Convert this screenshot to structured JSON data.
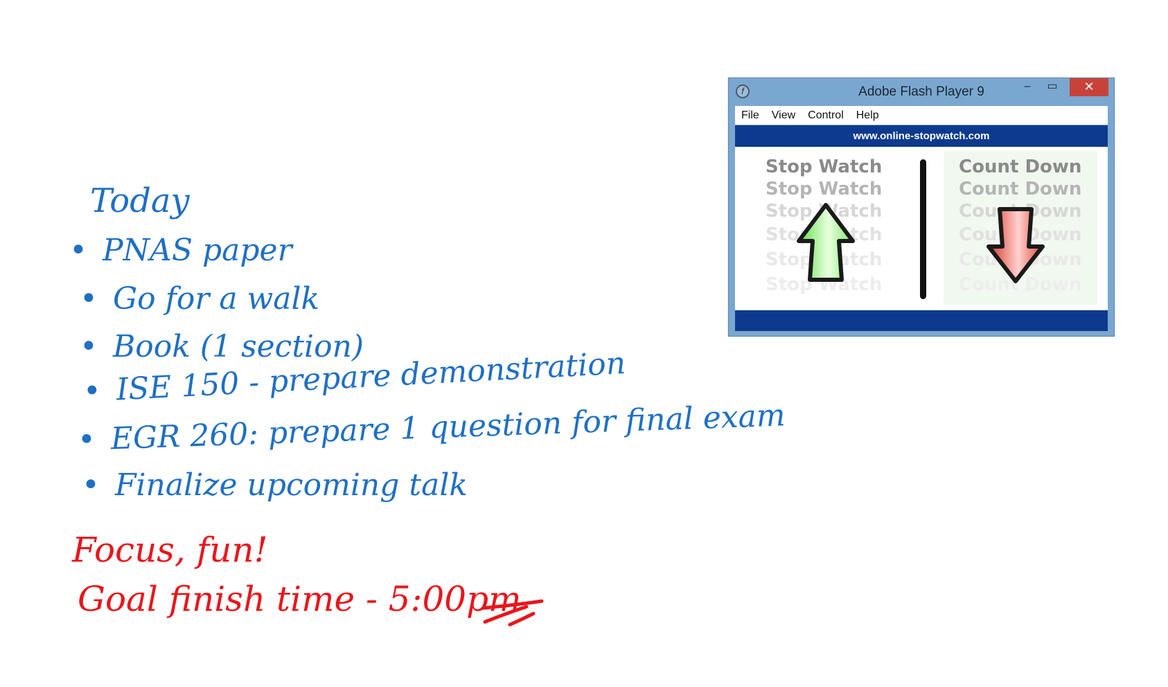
{
  "notes": {
    "title": "Today",
    "items": [
      "PNAS paper",
      "Go for a walk",
      "Book (1 section)",
      "ISE 150 - prepare demonstration",
      "EGR 260: prepare 1 question for final exam",
      "Finalize upcoming talk"
    ],
    "closing": [
      "Focus, fun!",
      "Goal finish time - 5:00pm"
    ],
    "ink_colors": {
      "blue": "#1f6fc4",
      "red": "#e8161b"
    }
  },
  "flash_window": {
    "title": "Adobe Flash Player 9",
    "controls": {
      "minimize": "–",
      "maximize": "▭",
      "close": "✕"
    },
    "menu": [
      "File",
      "View",
      "Control",
      "Help"
    ],
    "url": "www.online-stopwatch.com",
    "stopwatch_label": "Stop Watch",
    "countdown_label": "Count Down",
    "colors": {
      "bar": "#0e3a8e",
      "up_arrow": "#5fe04a",
      "down_arrow": "#d9342b"
    },
    "icons": {
      "app": "flash-player-icon",
      "up": "green-up-arrow-icon",
      "down": "red-down-arrow-icon"
    }
  }
}
